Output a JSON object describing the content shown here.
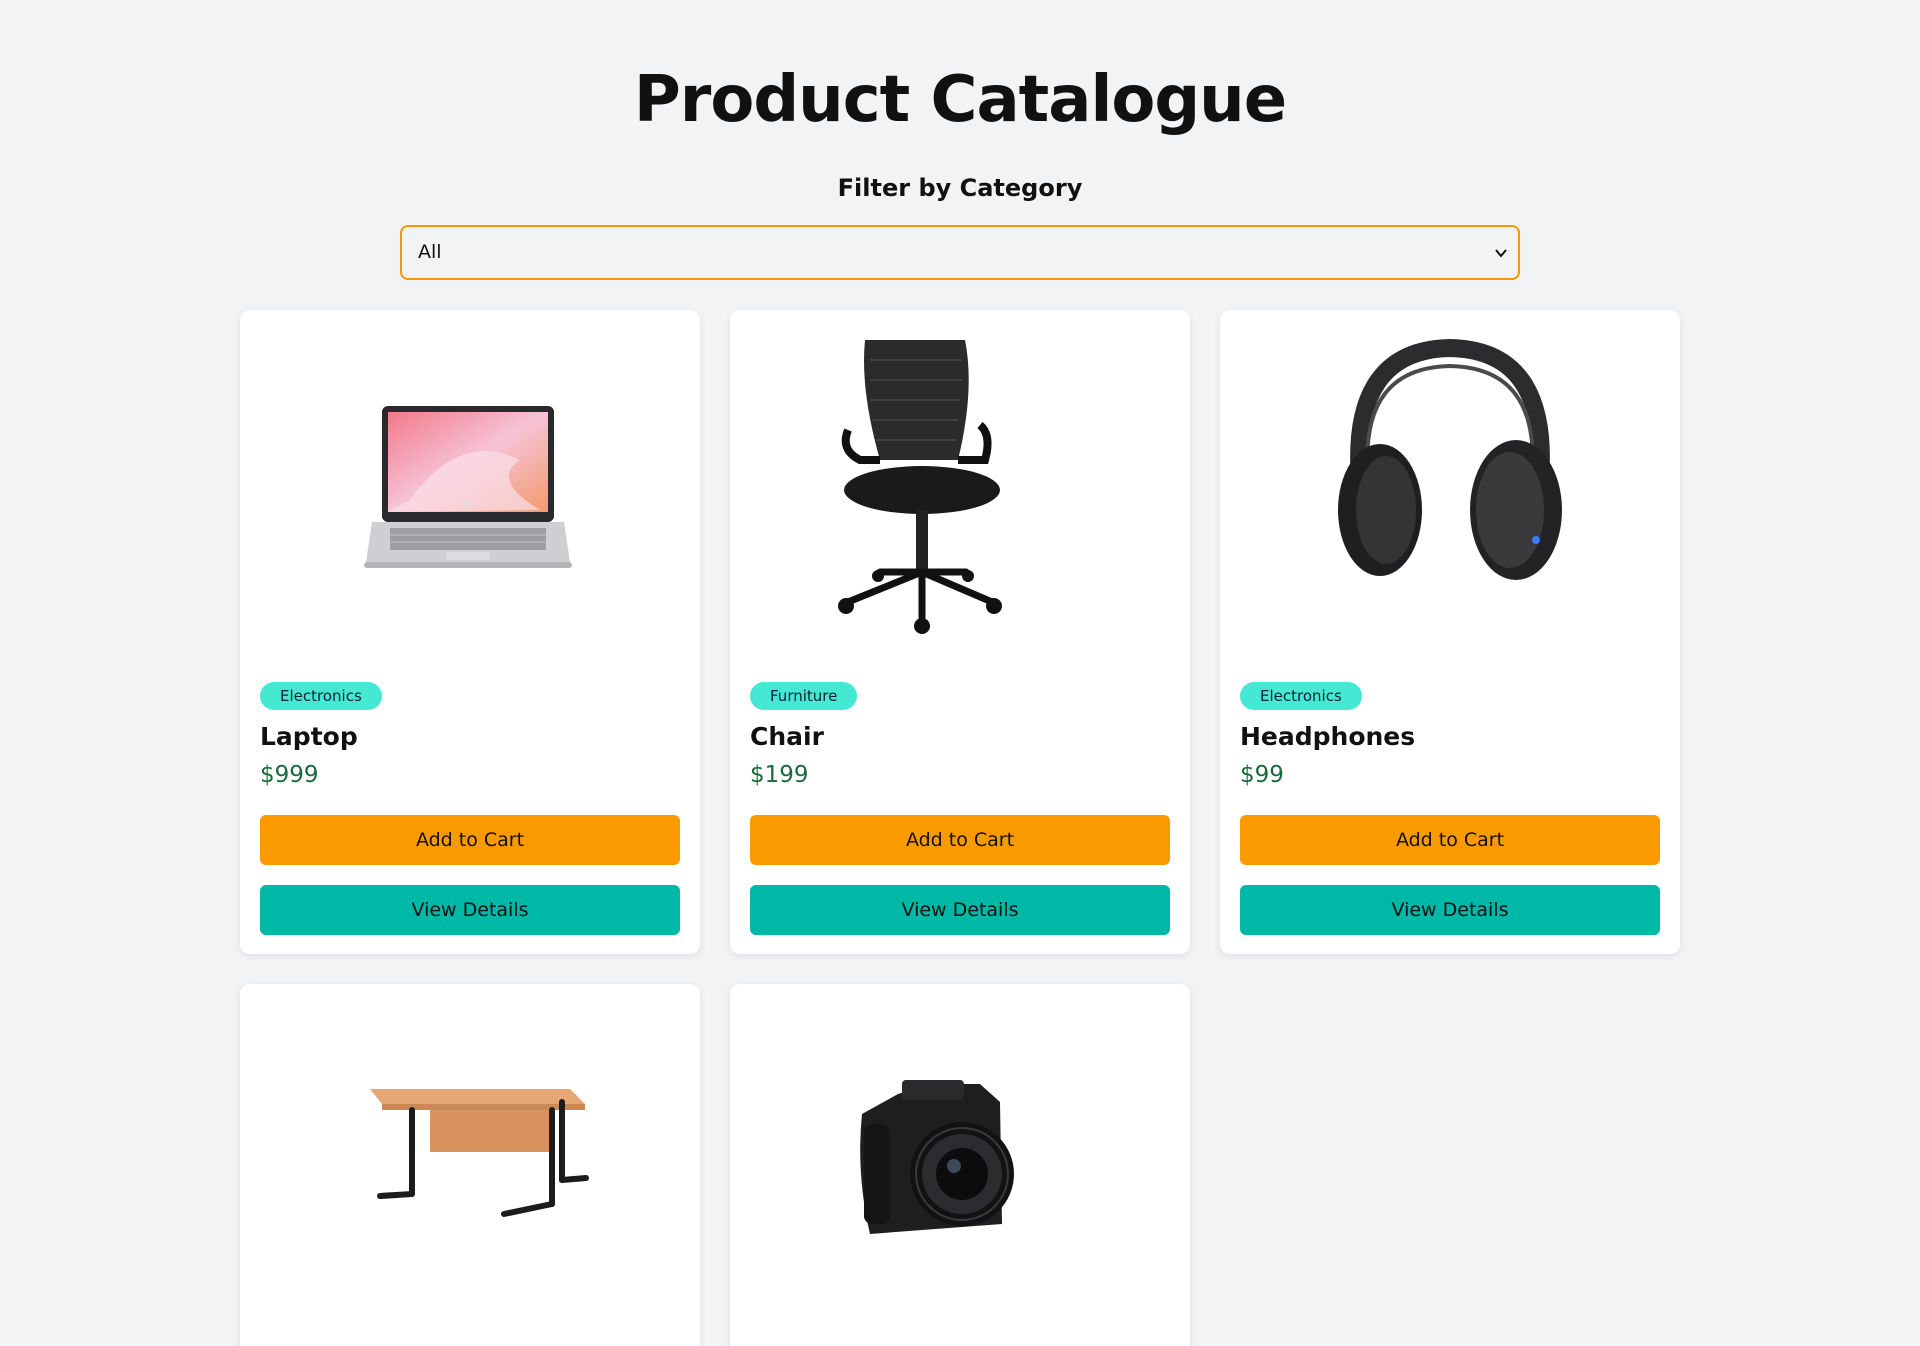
{
  "page": {
    "title": "Product Catalogue",
    "filter_label": "Filter by Category",
    "filter_value": "All"
  },
  "colors": {
    "background": "#f2f3f5",
    "select_border": "#f4980a",
    "badge": "#45e8d2",
    "price": "#1a6b3c",
    "add_to_cart": "#fb9a00",
    "view_details": "#00b8a6"
  },
  "products": [
    {
      "category": "Electronics",
      "name": "Laptop",
      "price": "$999",
      "add_label": "Add to Cart",
      "view_label": "View Details",
      "image": "laptop-image"
    },
    {
      "category": "Furniture",
      "name": "Chair",
      "price": "$199",
      "add_label": "Add to Cart",
      "view_label": "View Details",
      "image": "office-chair-image"
    },
    {
      "category": "Electronics",
      "name": "Headphones",
      "price": "$99",
      "add_label": "Add to Cart",
      "view_label": "View Details",
      "image": "headphones-image"
    },
    {
      "image": "desk-image"
    },
    {
      "image": "camera-image"
    }
  ]
}
